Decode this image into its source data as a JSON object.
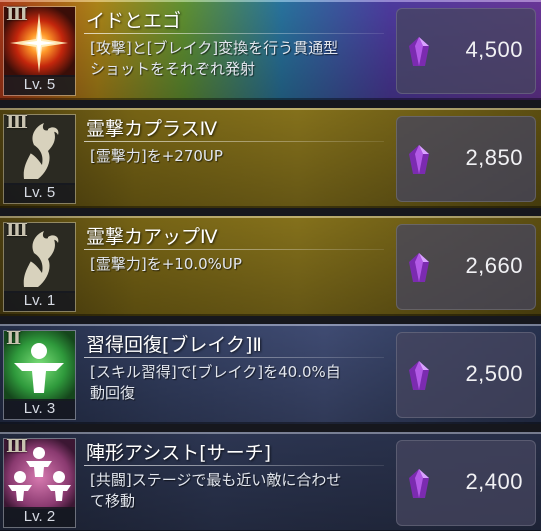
{
  "items": [
    {
      "rank": "Ⅲ",
      "title": "イドとエゴ",
      "description": "[攻撃]と[ブレイク]変換を行う貫通型\nショットをそれぞれ発射",
      "level": "Lv. 5",
      "price": "4,500",
      "icon": "starburst-icon"
    },
    {
      "rank": "Ⅲ",
      "title": "霊撃カプラスⅣ",
      "description": "[霊撃力]を+270UP",
      "level": "Lv. 5",
      "price": "2,850",
      "icon": "flame-hand-icon"
    },
    {
      "rank": "Ⅲ",
      "title": "霊撃カアップⅣ",
      "description": "[霊撃力]を+10.0%UP",
      "level": "Lv. 1",
      "price": "2,660",
      "icon": "flame-hand-icon"
    },
    {
      "rank": "Ⅱ",
      "title": "習得回復[ブレイク]Ⅱ",
      "description": "[スキル習得]で[ブレイク]を40.0%自\n動回復",
      "level": "Lv. 3",
      "price": "2,500",
      "icon": "person-burst-icon"
    },
    {
      "rank": "Ⅲ",
      "title": "陣形アシスト[サーチ]",
      "description": "[共闘]ステージで最も近い敵に合わせ\nて移動",
      "level": "Lv. 2",
      "price": "2,400",
      "icon": "formation-icon"
    }
  ],
  "colors": {
    "gem": "#9a3fd0",
    "price_box": "#46465f"
  }
}
